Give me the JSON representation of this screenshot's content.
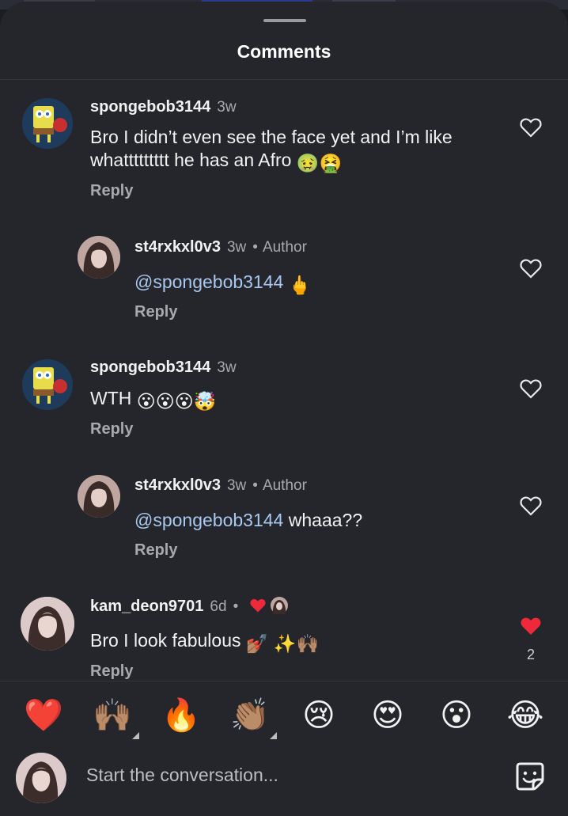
{
  "header": {
    "title": "Comments"
  },
  "comments": [
    {
      "username": "spongebob3144",
      "time": "3w",
      "text": "Bro I didn’t even see the face yet and I’m like",
      "text2": "whattttttttt he  has an Afro",
      "emojis": "🤢🤮",
      "reply": "Reply",
      "liked": false
    },
    {
      "username": "st4rxkxl0v3",
      "time": "3w",
      "author": "Author",
      "mention": "@spongebob3144",
      "text": "",
      "emojis": "🖕",
      "reply": "Reply",
      "liked": false
    },
    {
      "username": "spongebob3144",
      "time": "3w",
      "text": "WTH",
      "emojis": "😮😮😮🤯",
      "reply": "Reply",
      "liked": false
    },
    {
      "username": "st4rxkxl0v3",
      "time": "3w",
      "author": "Author",
      "mention": "@spongebob3144",
      "text": "whaaa??",
      "reply": "Reply",
      "liked": false
    },
    {
      "username": "kam_deon9701",
      "time": "6d",
      "text": "Bro I look fabulous",
      "emojis": "💅🏽 ✨🙌🏽",
      "reply": "Reply",
      "liked": true,
      "like_count": "2",
      "creator_liked": true
    }
  ],
  "reactions": [
    {
      "emoji": "❤️",
      "name": "red-heart"
    },
    {
      "emoji": "🙌🏽",
      "name": "raising-hands",
      "has_tone_menu": true
    },
    {
      "emoji": "🔥",
      "name": "fire"
    },
    {
      "emoji": "👏🏽",
      "name": "clapping-hands",
      "has_tone_menu": true
    },
    {
      "emoji": "😢",
      "name": "crying-face"
    },
    {
      "emoji": "😍",
      "name": "heart-eyes"
    },
    {
      "emoji": "😮",
      "name": "surprised-face"
    },
    {
      "emoji": "😂",
      "name": "laughing-face"
    }
  ],
  "composer": {
    "placeholder": "Start the conversation..."
  },
  "colors": {
    "like_red": "#ee2a3a",
    "mention_blue": "#a8c8f0",
    "sheet_bg": "#25262b"
  }
}
